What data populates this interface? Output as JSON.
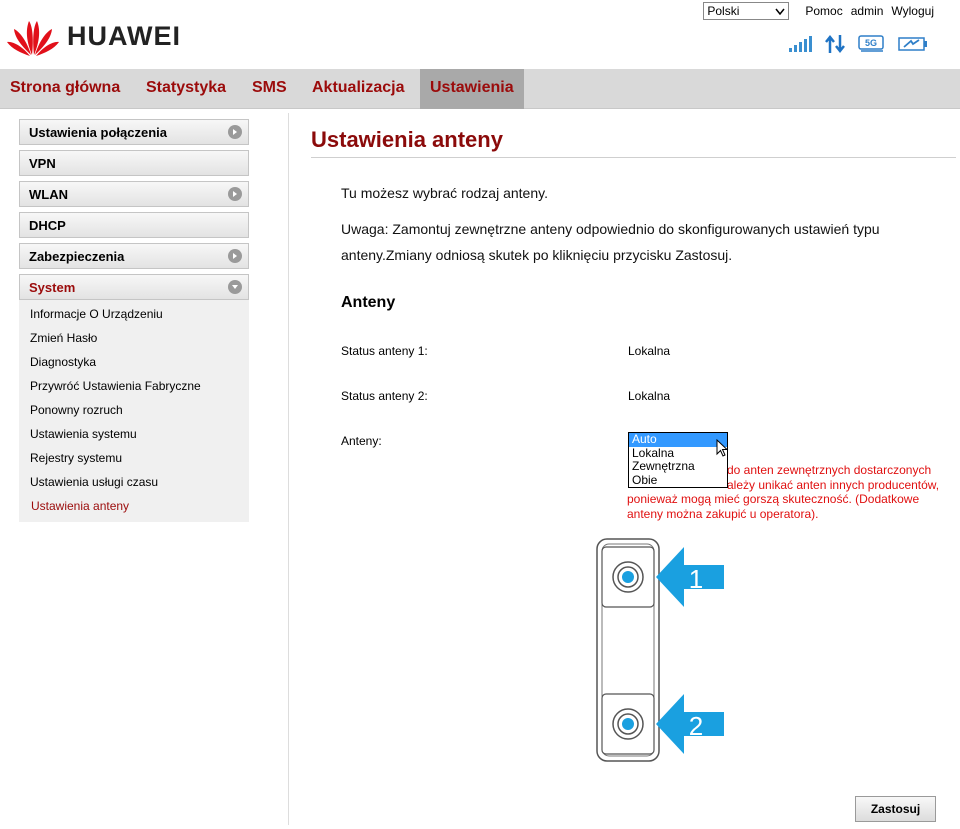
{
  "brand": {
    "name": "HUAWEI"
  },
  "top_links": {
    "language": "Polski",
    "help": "Pomoc",
    "user": "admin",
    "logout": "Wyloguj"
  },
  "status_icons": [
    "signal-icon",
    "data-transfer-icon",
    "network-5g-icon",
    "battery-icon"
  ],
  "colors": {
    "accent": "#9b0b0b",
    "warning": "#e01010",
    "arrow": "#1aa0e0",
    "selected": "#3399ff"
  },
  "nav": {
    "items": [
      "Strona główna",
      "Statystyka",
      "SMS",
      "Aktualizacja",
      "Ustawienia"
    ],
    "active": "Ustawienia"
  },
  "sidebar": {
    "sections": [
      {
        "label": "Ustawienia połączenia"
      },
      {
        "label": "VPN"
      },
      {
        "label": "WLAN"
      },
      {
        "label": "DHCP"
      },
      {
        "label": "Zabezpieczenia"
      },
      {
        "label": "System"
      }
    ],
    "system_items": [
      "Informacje O Urządzeniu",
      "Zmień Hasło",
      "Diagnostyka",
      "Przywróć Ustawienia Fabryczne",
      "Ponowny rozruch",
      "Ustawienia systemu",
      "Rejestry systemu",
      "Ustawienia usługi czasu",
      "Ustawienia anteny"
    ],
    "active_item": "Ustawienia anteny"
  },
  "main": {
    "title": "Ustawienia anteny",
    "intro": "Tu możesz wybrać rodzaj anteny.",
    "note_line1": "Uwaga: Zamontuj zewnętrzne anteny odpowiednio do skonfigurowanych ustawień typu",
    "note_line2": "anteny.Zmiany odniosą skutek po kliknięciu przycisku Zastosuj.",
    "section_title": "Anteny",
    "status1_label": "Status anteny 1:",
    "status1_value": "Lokalna",
    "status2_label": "Status anteny 2:",
    "status2_value": "Lokalna",
    "antennas_label": "Anteny:",
    "dropdown_options": [
      "Auto",
      "Lokalna",
      "Zewnętrzna",
      "Obie"
    ],
    "dropdown_selected": "Auto",
    "warning_line1": "do anten zewnętrznych dostarczonych",
    "warning_line2": "ależy unikać anten innych producentów,",
    "warning_line3": "ponieważ mogą mieć gorszą skuteczność. (Dodatkowe",
    "warning_line4": "anteny można zakupić u operatora).",
    "port1_number": "1",
    "port2_number": "2",
    "apply_button": "Zastosuj"
  }
}
